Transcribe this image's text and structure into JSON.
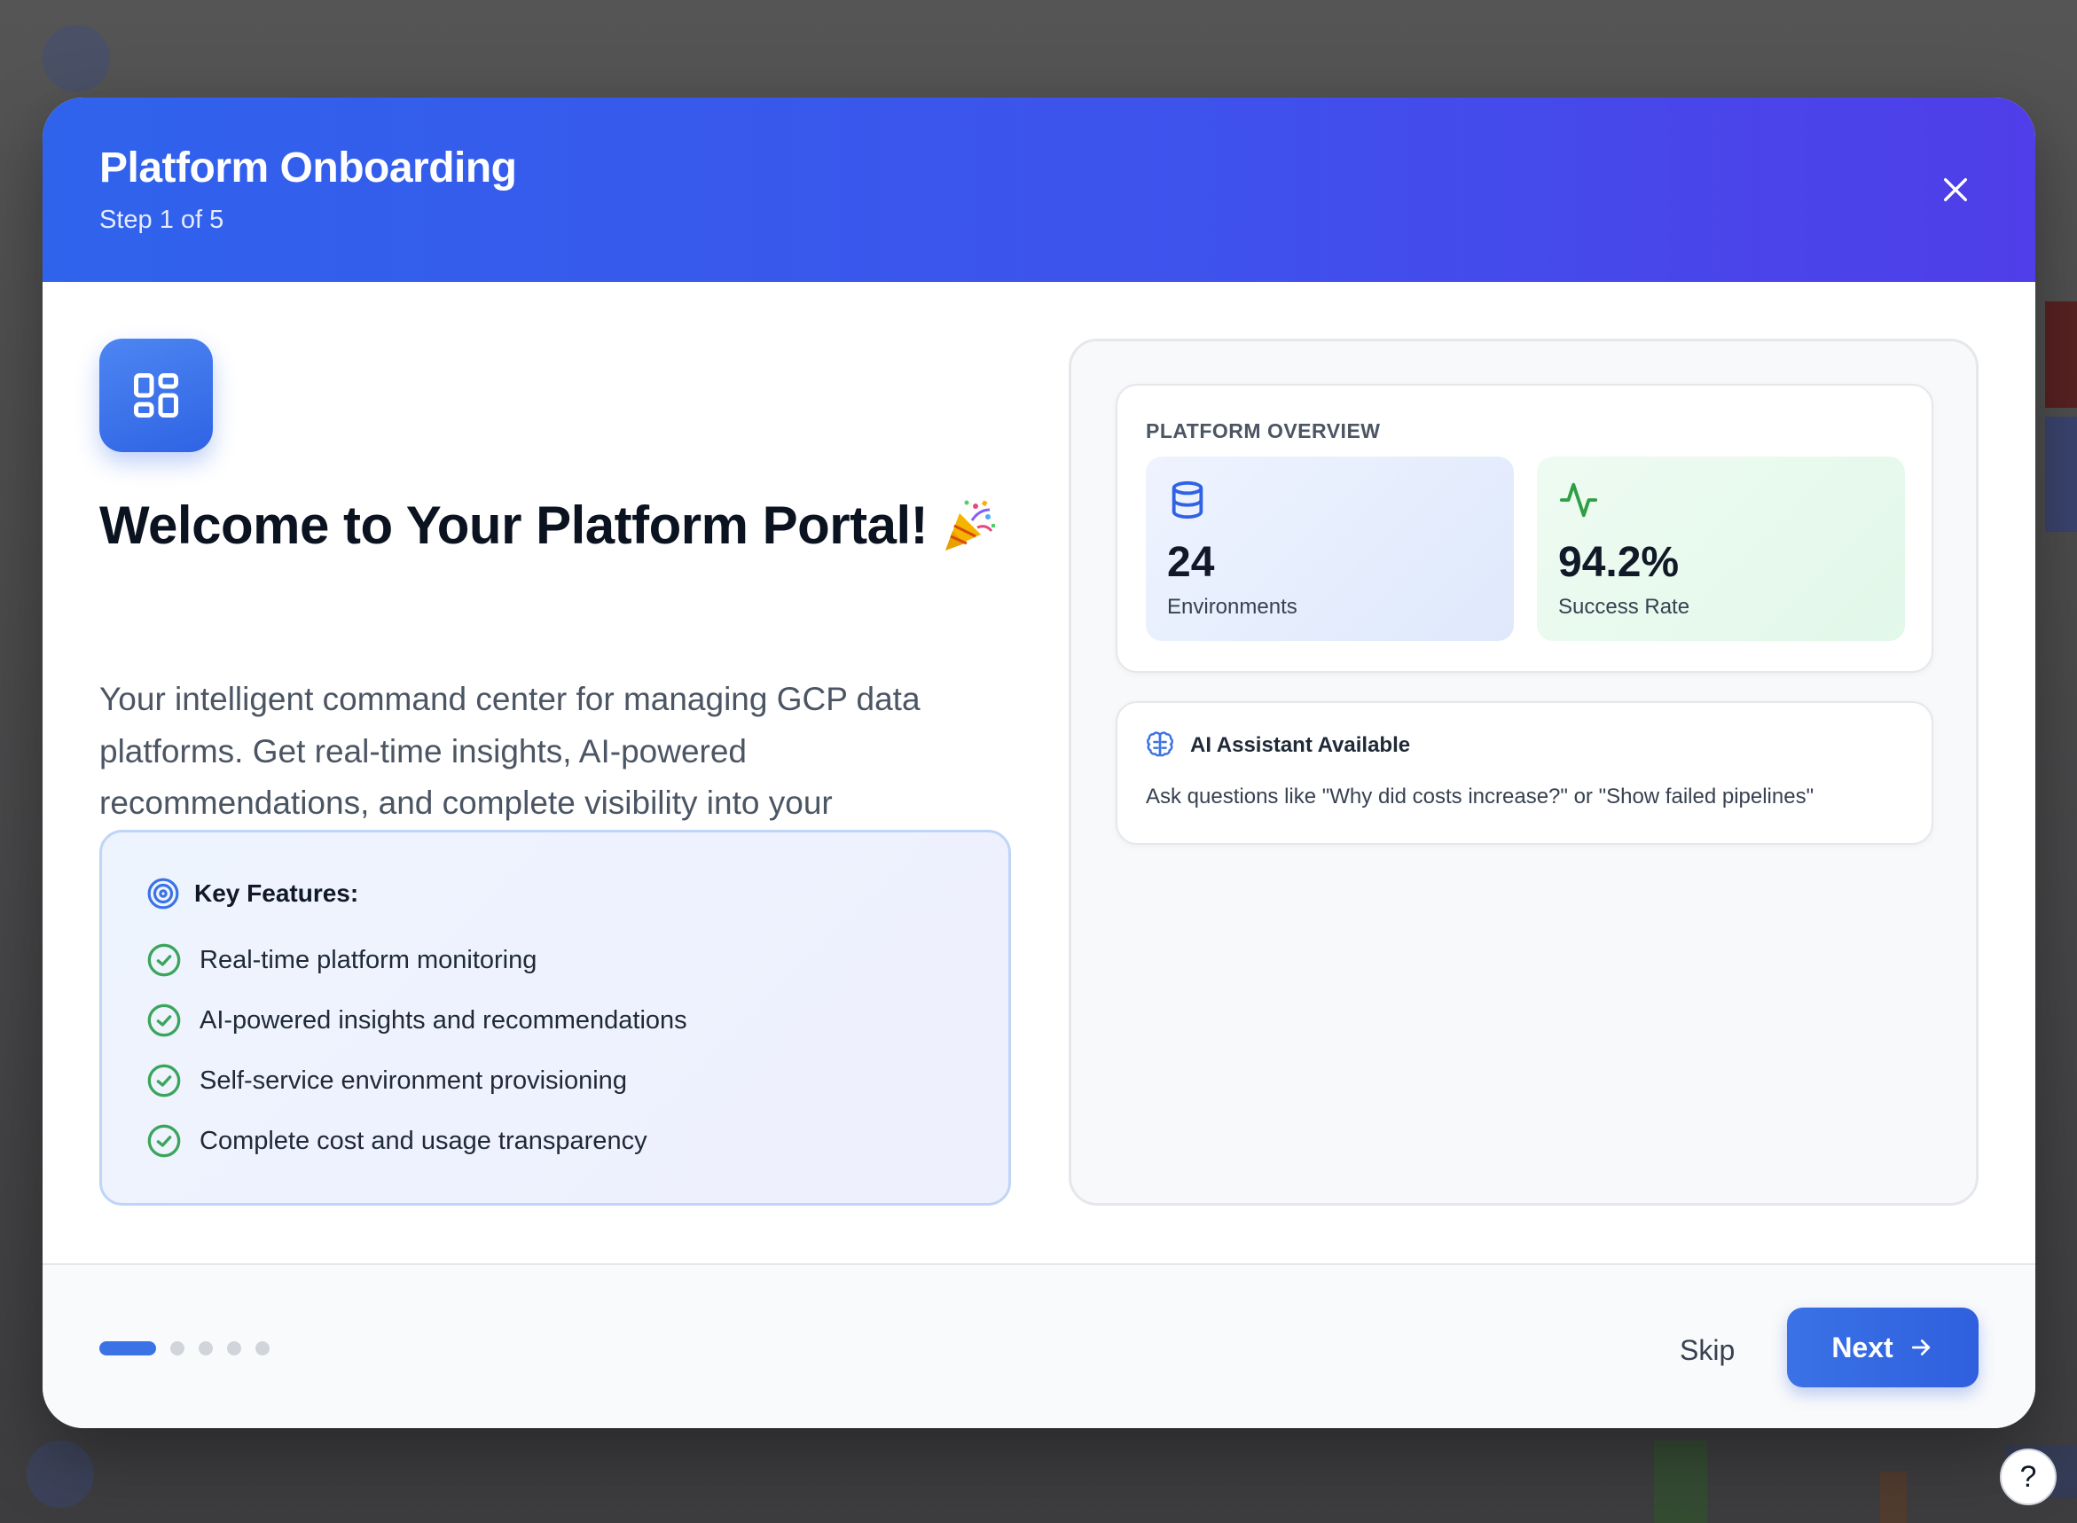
{
  "modal": {
    "title": "Platform Onboarding",
    "step": "Step 1 of 5",
    "close_icon": "close-icon"
  },
  "welcome": {
    "icon": "dashboard-grid-icon",
    "title": "Welcome to Your Platform Portal!",
    "emoji_icon": "party-popper-icon",
    "description": "Your intelligent command center for managing GCP data platforms. Get real-time insights, AI-powered recommendations, and complete visibility into your infrastructure."
  },
  "features": {
    "heading": "Key Features:",
    "heading_icon": "target-icon",
    "items": [
      {
        "label": "Real-time platform monitoring",
        "icon": "check-circle-icon"
      },
      {
        "label": "AI-powered insights and recommendations",
        "icon": "check-circle-icon"
      },
      {
        "label": "Self-service environment provisioning",
        "icon": "check-circle-icon"
      },
      {
        "label": "Complete cost and usage transparency",
        "icon": "check-circle-icon"
      }
    ]
  },
  "overview": {
    "label": "PLATFORM OVERVIEW",
    "environments": {
      "value": "24",
      "caption": "Environments",
      "icon": "database-icon"
    },
    "success_rate": {
      "value": "94.2%",
      "caption": "Success Rate",
      "icon": "activity-icon"
    }
  },
  "assistant": {
    "title": "AI Assistant Available",
    "icon": "brain-icon",
    "description": "Ask questions like \"Why did costs increase?\" or \"Show failed pipelines\""
  },
  "footer": {
    "progress": {
      "current_step": 1,
      "total_steps": 5
    },
    "skip_label": "Skip",
    "next_label": "Next",
    "next_icon": "arrow-right-icon"
  },
  "help": {
    "label": "?"
  },
  "colors": {
    "header_start": "#2f63ec",
    "header_end": "#4f3ee9",
    "primary": "#3b72e6",
    "success": "#3ba55c"
  }
}
